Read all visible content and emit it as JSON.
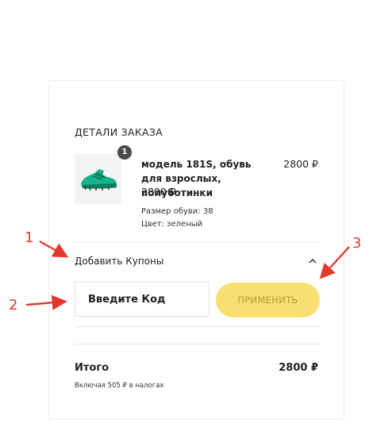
{
  "order": {
    "heading": "ДЕТАЛИ ЗАКАЗА",
    "item": {
      "quantity": "1",
      "name": "модель 181S, обувь для взрослых, полуботинки",
      "unit_price": "2800 ₽",
      "price": "2800 ₽",
      "size_label": "Размер обуви: 38",
      "color_label": "Цвет: зеленый",
      "image_icon": "green-sneaker-image"
    }
  },
  "coupon": {
    "toggle_label": "Добавить Купоны",
    "toggle_icon": "chevron-up-icon",
    "input_placeholder": "Введите Код",
    "input_value": "",
    "apply_label": "ПРИМЕНИТЬ"
  },
  "summary": {
    "total_label": "Итого",
    "total_value": "2800 ₽",
    "tax_note": "Включая 505 ₽ в налогах"
  },
  "annotations": [
    "1",
    "2",
    "3"
  ],
  "colors": {
    "accent_button": "#f8df72",
    "annotation": "#e4382c",
    "badge": "#4a4a4a"
  }
}
